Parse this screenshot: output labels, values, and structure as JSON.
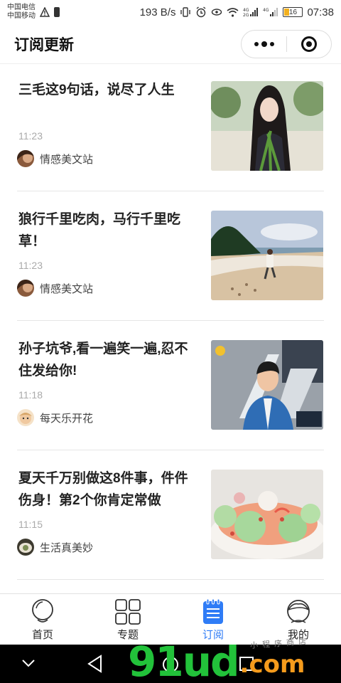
{
  "status_bar": {
    "carrier1": "中国电信",
    "carrier2": "中国移动",
    "net_speed": "193 B/s",
    "battery": "16",
    "time": "07:38"
  },
  "header": {
    "title": "订阅更新"
  },
  "articles": [
    {
      "title": "三毛这9句话，说尽了人生",
      "time": "11:23",
      "author": "情感美文站"
    },
    {
      "title": "狼行千里吃肉，马行千里吃草！",
      "time": "11:23",
      "author": "情感美文站"
    },
    {
      "title": "孙子坑爷,看一遍笑一遍,忍不住发给你!",
      "time": "11:18",
      "author": "每天乐开花"
    },
    {
      "title": "夏天千万别做这8件事，件件伤身！第2个你肯定常做",
      "time": "11:15",
      "author": "生活真美妙"
    }
  ],
  "tabbar": {
    "items": [
      {
        "label": "首页",
        "icon": "home-icon"
      },
      {
        "label": "专题",
        "icon": "grid-icon"
      },
      {
        "label": "订阅",
        "icon": "notepad-icon"
      },
      {
        "label": "我的",
        "icon": "profile-icon"
      }
    ],
    "active": "订阅",
    "active_color": "#2f7cf6"
  },
  "watermark": {
    "main": "91ud",
    "tld": ".com",
    "small": "小程序商店"
  }
}
